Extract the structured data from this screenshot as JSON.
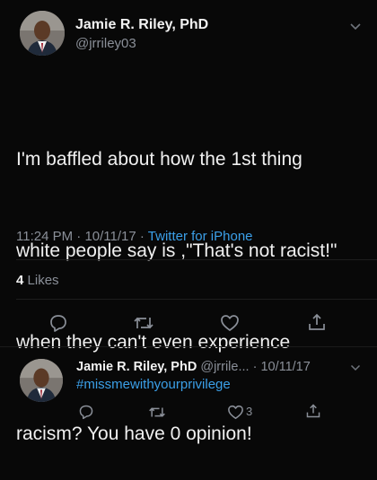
{
  "tweet": {
    "author_name": "Jamie R. Riley, PhD",
    "handle": "@jrriley03",
    "text_lines": [
      "I'm baffled about how the 1st thing",
      "white people say is ,\"That's not racist!\"",
      "when they can't even experience",
      "racism? You have 0 opinion!"
    ],
    "time": "11:24 PM",
    "separator1": " · ",
    "date": "10/11/17",
    "separator2": " · ",
    "source": "Twitter for iPhone",
    "likes_count": "4",
    "likes_label": "Likes"
  },
  "actions": {
    "reply_icon": "reply-icon",
    "retweet_icon": "retweet-icon",
    "like_icon": "heart-icon",
    "share_icon": "share-icon"
  },
  "reply": {
    "author_name": "Jamie R. Riley, PhD",
    "handle": "@jrrile...",
    "separator": " · ",
    "date": "10/11/17",
    "hashtag": "#missmewithyourprivilege",
    "like_count": "3"
  },
  "colors": {
    "background": "#080808",
    "link": "#3b9fe8",
    "muted": "#8a8f98"
  }
}
